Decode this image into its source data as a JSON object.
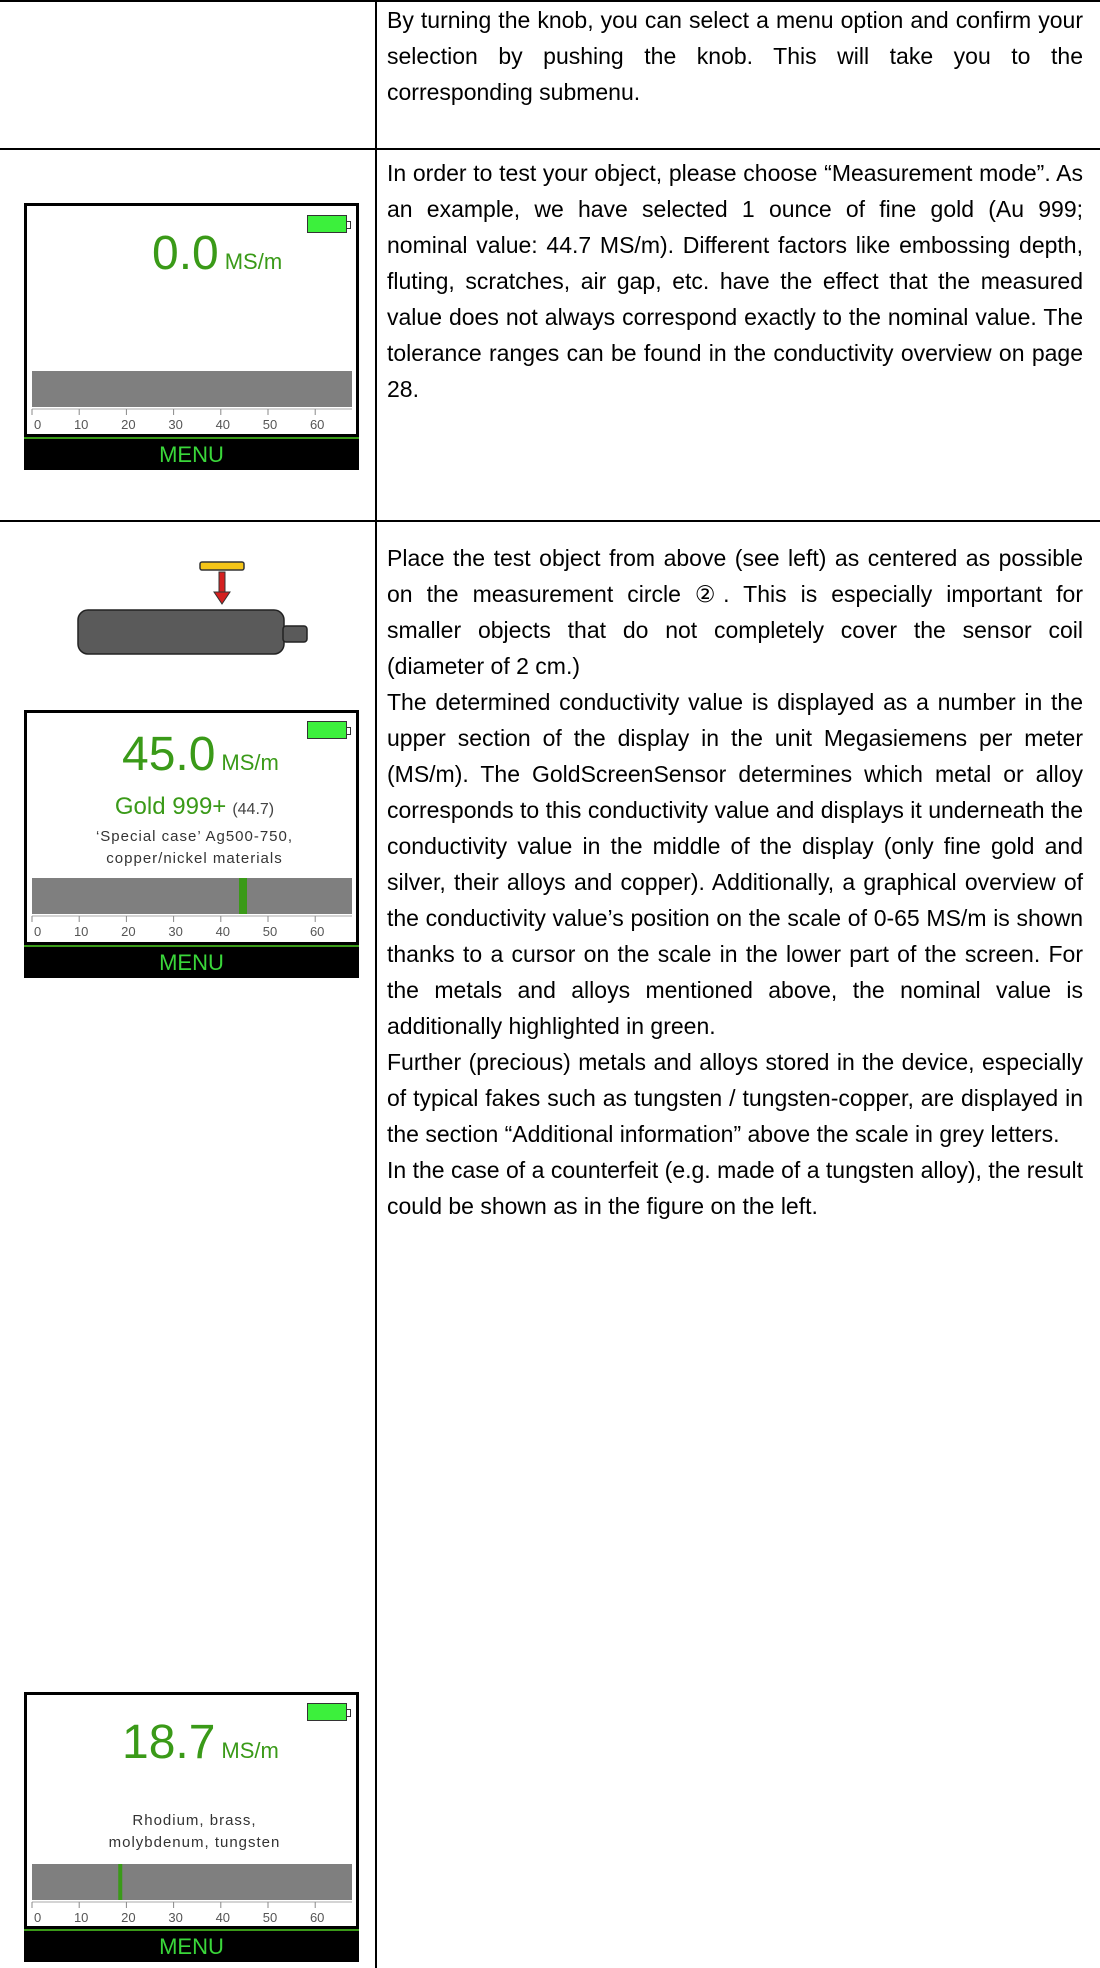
{
  "rows": [
    {
      "text": "By turning the knob, you can select a menu option and confirm your selection by pushing the knob. This will take you to the corresponding submenu."
    },
    {
      "text": "In order to test your object, please choose “Measurement mode”. As an example, we have selected 1 ounce of fine gold (Au 999; nominal value: 44.7 MS/m). Different factors like embossing depth, fluting, scratches, air gap, etc. have the effect that the measured value does not always correspond exactly to the nominal value. The tolerance ranges can be found in the conductivity overview on page 28."
    },
    {
      "paragraphs": [
        "Place the test object from above (see left) as centered as possible on the measurement circle ②. This is especially important for smaller objects that do not completely cover the sensor coil (diameter of 2 cm.)",
        "The determined conductivity value is displayed as a number in the upper section of the display in the unit Megasiemens per meter (MS/m). The GoldScreenSensor determines which metal or alloy corresponds to this conductivity value and displays it underneath the conductivity value in the middle of the display (only fine gold and silver, their alloys and copper). Additionally, a graphical overview of the conductivity value’s position on the scale of 0-65 MS/m is shown thanks to a cursor on the scale in the lower part of the screen. For the metals and alloys mentioned above, the nominal value is additionally highlighted in green.",
        "Further (precious) metals and alloys stored in the device, especially of typical fakes such as tungsten / tungsten-copper, are displayed in the section “Additional information” above the scale in grey letters.",
        "In the case of a counterfeit (e.g. made of a tungsten alloy), the result could be shown as in the figure on the left."
      ]
    }
  ],
  "screens": [
    {
      "reading": "0.0",
      "unit": "MS/m",
      "metal": "",
      "nominal": "",
      "info": [],
      "cursor": null,
      "nominal_mark": null,
      "menu": "MENU"
    },
    {
      "reading": "45.0",
      "unit": "MS/m",
      "metal": "Gold  999+",
      "nominal": "(44.7)",
      "info": [
        "‘Special case’ Ag500-750,",
        "copper/nickel materials"
      ],
      "cursor": 45.0,
      "nominal_mark": 44.7,
      "menu": "MENU"
    },
    {
      "reading": "18.7",
      "unit": "MS/m",
      "metal": "",
      "nominal": "",
      "info": [
        "Rhodium, brass,",
        "molybdenum, tungsten"
      ],
      "cursor": 18.7,
      "nominal_mark": null,
      "menu": "MENU"
    }
  ],
  "scale": {
    "min": 0,
    "max": 65,
    "ticks": [
      "0",
      "10",
      "20",
      "30",
      "40",
      "50",
      "60"
    ]
  },
  "colors": {
    "reading_green": "#3a9a18",
    "battery_green": "#3cf03c",
    "scale_grey": "#7f7f7f",
    "menu_text": "#3ad73a",
    "probe_red": "#d42020",
    "probe_yellow": "#f5c518",
    "device_grey": "#5a5a5a"
  }
}
